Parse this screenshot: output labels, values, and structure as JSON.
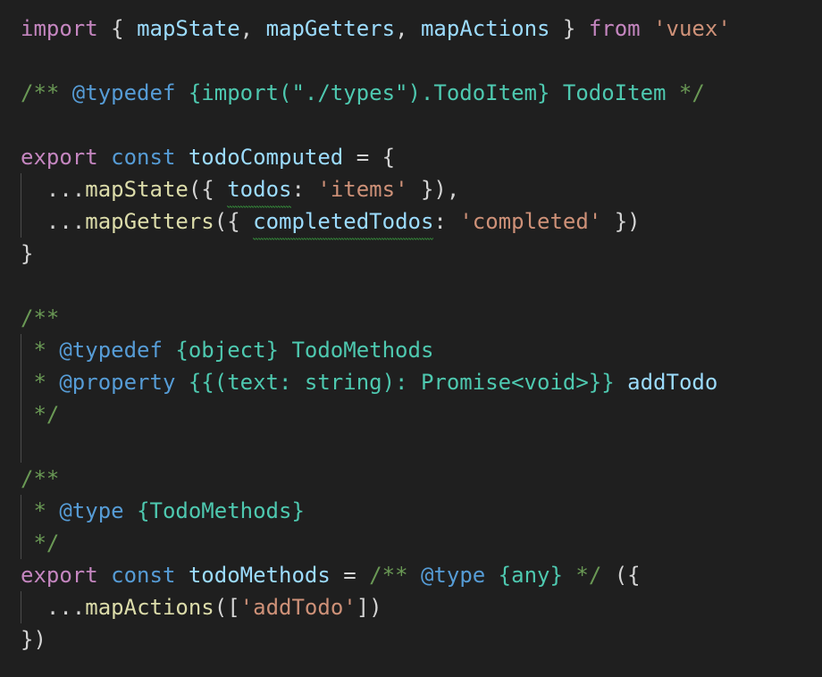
{
  "editor": {
    "language": "javascript",
    "background_color": "#1f1f1f",
    "default_text_color": "#d4d4d4",
    "indent_guide_color": "#4b4b4b",
    "squiggle_color": "#3cb043",
    "font_size_px": 24,
    "line_height_px": 36,
    "colors": {
      "keyword": "#c586c0",
      "declaration": "#569cd6",
      "variable": "#9cdcfe",
      "function": "#dcdcaa",
      "string": "#ce9178",
      "punctuation": "#d4d4d4",
      "comment": "#6a9955",
      "jsdoc_tag": "#569cd6",
      "type": "#4ec9b0"
    }
  },
  "code": {
    "line1": {
      "import_kw": "import",
      "open_brace": " { ",
      "map_state": "mapState",
      "comma1": ", ",
      "map_getters": "mapGetters",
      "comma2": ", ",
      "map_actions": "mapActions",
      "close_brace": " } ",
      "from_kw": "from",
      "space": " ",
      "module": "'vuex'"
    },
    "line3": {
      "comment_open": "/** ",
      "tag": "@typedef",
      "space": " ",
      "type_expr": "{import(\"./types\").TodoItem} TodoItem",
      "comment_close": " */"
    },
    "line5": {
      "export_kw": "export",
      "space1": " ",
      "const_kw": "const",
      "space2": " ",
      "name": "todoComputed",
      "assign": " = {"
    },
    "line6": {
      "indent": "  ",
      "spread": "...",
      "func": "mapState",
      "open": "({ ",
      "key": "todos",
      "colon": ": ",
      "value": "'items'",
      "close": " }),"
    },
    "line7": {
      "indent": "  ",
      "spread": "...",
      "func": "mapGetters",
      "open": "({ ",
      "key": "completedTodos",
      "colon": ": ",
      "value": "'completed'",
      "close": " })"
    },
    "line8": {
      "close_brace": "}"
    },
    "line10": {
      "comment_open": "/**"
    },
    "line11": {
      "star": " * ",
      "tag": "@typedef",
      "space": " ",
      "type_expr": "{object} TodoMethods"
    },
    "line12": {
      "star": " * ",
      "tag": "@property",
      "space": " ",
      "type_expr": "{{(text: string): Promise<void>}}",
      "space2": " ",
      "prop_name": "addTodo"
    },
    "line13": {
      "comment_close": " */"
    },
    "line15": {
      "comment_open": "/**"
    },
    "line16": {
      "star": " * ",
      "tag": "@type",
      "space": " ",
      "type_expr": "{TodoMethods}"
    },
    "line17": {
      "comment_close": " */"
    },
    "line18": {
      "export_kw": "export",
      "space1": " ",
      "const_kw": "const",
      "space2": " ",
      "name": "todoMethods",
      "assign": " = ",
      "inline_comment_open": "/** ",
      "inline_tag": "@type",
      "inline_space": " ",
      "inline_type": "{any}",
      "inline_comment_close": " */",
      "tail": " ({"
    },
    "line19": {
      "indent": "  ",
      "spread": "...",
      "func": "mapActions",
      "open": "([",
      "value": "'addTodo'",
      "close": "])"
    },
    "line20": {
      "close": "})"
    }
  }
}
